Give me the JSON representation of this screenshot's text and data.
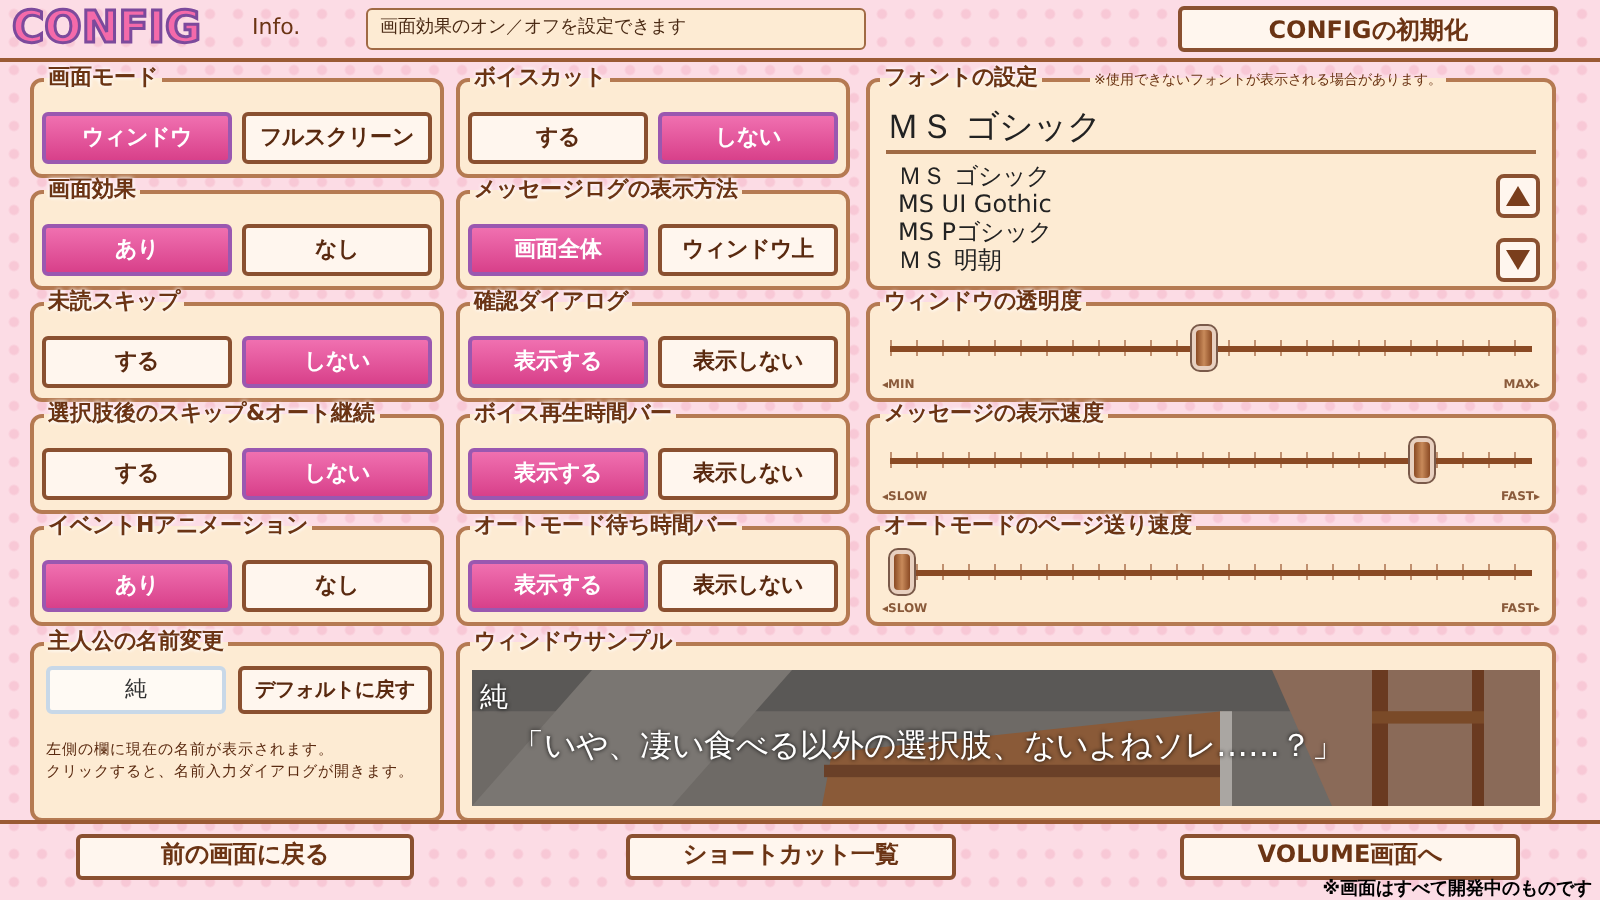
{
  "header": {
    "logo": "CONFIG",
    "info_label": "Info.",
    "info_text": "画面効果のオン／オフを設定できます",
    "reset_button": "CONFIGの初期化"
  },
  "left_column": [
    {
      "title": "画面モード",
      "options": [
        {
          "label": "ウィンドウ",
          "selected": true
        },
        {
          "label": "フルスクリーン",
          "selected": false
        }
      ]
    },
    {
      "title": "画面効果",
      "options": [
        {
          "label": "あり",
          "selected": true
        },
        {
          "label": "なし",
          "selected": false
        }
      ]
    },
    {
      "title": "未読スキップ",
      "options": [
        {
          "label": "する",
          "selected": false
        },
        {
          "label": "しない",
          "selected": true
        }
      ]
    },
    {
      "title": "選択肢後のスキップ&オート継続",
      "options": [
        {
          "label": "する",
          "selected": false
        },
        {
          "label": "しない",
          "selected": true
        }
      ]
    },
    {
      "title": "イベントHアニメーション",
      "options": [
        {
          "label": "あり",
          "selected": true
        },
        {
          "label": "なし",
          "selected": false
        }
      ]
    }
  ],
  "middle_column": [
    {
      "title": "ボイスカット",
      "options": [
        {
          "label": "する",
          "selected": false
        },
        {
          "label": "しない",
          "selected": true
        }
      ]
    },
    {
      "title": "メッセージログの表示方法",
      "options": [
        {
          "label": "画面全体",
          "selected": true
        },
        {
          "label": "ウィンドウ上",
          "selected": false
        }
      ]
    },
    {
      "title": "確認ダイアログ",
      "options": [
        {
          "label": "表示する",
          "selected": true
        },
        {
          "label": "表示しない",
          "selected": false
        }
      ]
    },
    {
      "title": "ボイス再生時間バー",
      "options": [
        {
          "label": "表示する",
          "selected": true
        },
        {
          "label": "表示しない",
          "selected": false
        }
      ]
    },
    {
      "title": "オートモード待ち時間バー",
      "options": [
        {
          "label": "表示する",
          "selected": true
        },
        {
          "label": "表示しない",
          "selected": false
        }
      ]
    }
  ],
  "font_settings": {
    "title": "フォントの設定",
    "note": "※使用できないフォントが表示される場合があります。",
    "current": "ＭＳ ゴシック",
    "fonts": [
      "ＭＳ ゴシック",
      "MS UI Gothic",
      "MS Pゴシック",
      "ＭＳ 明朝"
    ]
  },
  "sliders": [
    {
      "title": "ウィンドウの透明度",
      "level": 0.49,
      "min_label": "◂MIN",
      "max_label": "MAX▸"
    },
    {
      "title": "メッセージの表示速度",
      "level": 0.84,
      "min_label": "◂SLOW",
      "max_label": "FAST▸"
    },
    {
      "title": "オートモードのページ送り速度",
      "level": 0,
      "min_label": "◂SLOW",
      "max_label": "FAST▸"
    }
  ],
  "name_change": {
    "title": "主人公の名前変更",
    "name": "純",
    "default_button": "デフォルトに戻す",
    "help_lines": [
      "左側の欄に現在の名前が表示されます。",
      "クリックすると、名前入力ダイアログが開きます。"
    ]
  },
  "window_sample": {
    "title": "ウィンドウサンプル",
    "speaker": "純",
    "line": "「いや、凄い食べる以外の選択肢、ないよねソレ……？」"
  },
  "footer": {
    "buttons": [
      "前の画面に戻る",
      "ショートカット一覧",
      "VOLUME画面へ"
    ],
    "note": "※画面はすべて開発中のものです"
  }
}
